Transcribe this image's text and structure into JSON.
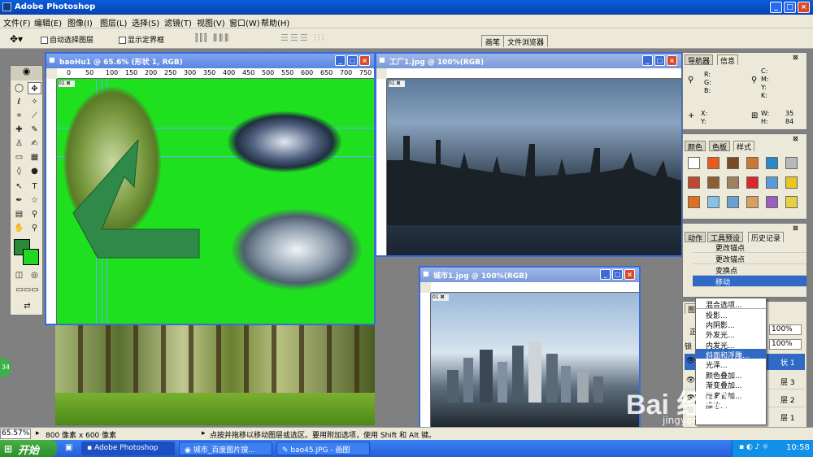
{
  "app": {
    "title": "Adobe Photoshop"
  },
  "menu": [
    "文件(F)",
    "编辑(E)",
    "图像(I)",
    "图层(L)",
    "选择(S)",
    "滤镜(T)",
    "视图(V)",
    "窗口(W)",
    "帮助(H)"
  ],
  "options": {
    "auto_select": "自动选择图层",
    "show_bounds": "显示定界框",
    "tab_brush": "画笔",
    "tab_browser": "文件浏览器"
  },
  "docs": [
    {
      "title": "baoHu1 @ 65.6% (形状 1, RGB)"
    },
    {
      "title": "工厂1.jpg @ 100%(RGB)"
    },
    {
      "title": "城市1.jpg @ 100%(RGB)"
    }
  ],
  "ruler1": [
    "0",
    "50",
    "100",
    "150",
    "200",
    "250",
    "300",
    "350",
    "400",
    "450",
    "500",
    "550",
    "600",
    "650",
    "700",
    "750"
  ],
  "info": {
    "tab_nav": "导航器",
    "tab_info": "信息",
    "rgb": "R:\nG:\nB:",
    "cmyk": "C:\nM:\nY:\nK:",
    "xy": "X:\nY:",
    "wh": "W:\nH:",
    "w": "35",
    "h": "84"
  },
  "color_tabs": [
    "颜色",
    "色板",
    "样式"
  ],
  "history": {
    "tabs": [
      "动作",
      "工具预设",
      "历史记录"
    ],
    "items": [
      "更改锚点",
      "更改锚点",
      "变换点",
      "移动"
    ]
  },
  "layers": {
    "tab": "图",
    "mode": "正",
    "opacity": "100%",
    "fill": "100%",
    "lock": "锁",
    "items": [
      "状 1",
      "层 3",
      "层 2",
      "层 1"
    ]
  },
  "context_menu": [
    "混合选项...",
    "投影...",
    "内阴影...",
    "外发光...",
    "内发光...",
    "斜面和浮雕...",
    "光泽...",
    "颜色叠加...",
    "渐变叠加...",
    "图案叠加...",
    "描边..."
  ],
  "status": {
    "zoom": "65.57%",
    "size": "800 像素 x 600 像素",
    "hint": "点按并拖移以移动图层或选区。要用附加选项，使用 Shift 和 Alt 键。"
  },
  "taskbar": {
    "start": "开始",
    "tasks": [
      "Adobe Photoshop",
      "城市_百度图片搜...",
      "bao45.JPG - 画图"
    ],
    "clock": "10:58"
  },
  "watermark": {
    "main": "Bai 经验",
    "sub": "jingyan.baidu.com"
  },
  "badge": "34"
}
